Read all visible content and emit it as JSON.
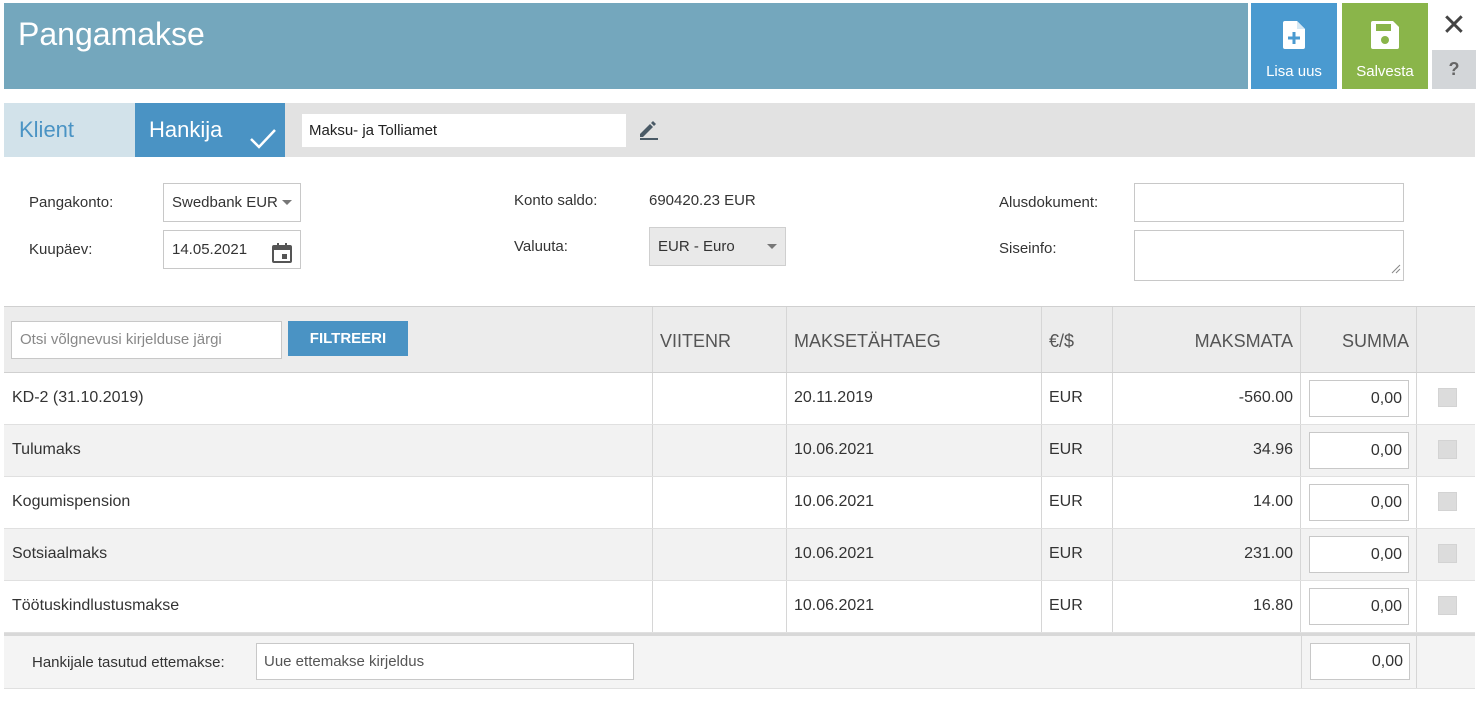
{
  "header": {
    "title": "Pangamakse",
    "add_label": "Lisa uus",
    "save_label": "Salvesta",
    "close_glyph": "✕",
    "help_glyph": "?",
    "colors": {
      "bar": "#74a7bd",
      "add": "#4a9ad0",
      "save": "#8ab54a"
    }
  },
  "party": {
    "tab_client": "Klient",
    "tab_supplier": "Hankija",
    "name": "Maksu- ja Tolliamet"
  },
  "form": {
    "bank_label": "Pangakonto:",
    "bank_value": "Swedbank EUR",
    "date_label": "Kuupäev:",
    "date_value": "14.05.2021",
    "balance_label": "Konto saldo:",
    "balance_value": "690420.23 EUR",
    "currency_label": "Valuuta:",
    "currency_value": "EUR - Euro",
    "base_doc_label": "Alusdokument:",
    "base_doc_value": "",
    "internal_label": "Siseinfo:",
    "internal_value": ""
  },
  "table": {
    "search_placeholder": "Otsi võlgnevusi kirjelduse järgi",
    "filter_label": "FILTREERI",
    "headers": {
      "ref": "VIITENR",
      "due": "MAKSETÄHTAEG",
      "currency": "€/$",
      "unpaid": "MAKSMATA",
      "amount": "SUMMA"
    },
    "rows": [
      {
        "desc": "KD-2 (31.10.2019)",
        "ref": "",
        "due": "20.11.2019",
        "cur": "EUR",
        "unpaid": "-560.00",
        "amount": "0,00"
      },
      {
        "desc": "Tulumaks",
        "ref": "",
        "due": "10.06.2021",
        "cur": "EUR",
        "unpaid": "34.96",
        "amount": "0,00"
      },
      {
        "desc": "Kogumispension",
        "ref": "",
        "due": "10.06.2021",
        "cur": "EUR",
        "unpaid": "14.00",
        "amount": "0,00"
      },
      {
        "desc": "Sotsiaalmaks",
        "ref": "",
        "due": "10.06.2021",
        "cur": "EUR",
        "unpaid": "231.00",
        "amount": "0,00"
      },
      {
        "desc": "Töötuskindlustusmakse",
        "ref": "",
        "due": "10.06.2021",
        "cur": "EUR",
        "unpaid": "16.80",
        "amount": "0,00"
      }
    ],
    "footer": {
      "label": "Hankijale tasutud ettemakse:",
      "desc_value": "Uue ettemakse kirjeldus",
      "amount": "0,00"
    }
  }
}
